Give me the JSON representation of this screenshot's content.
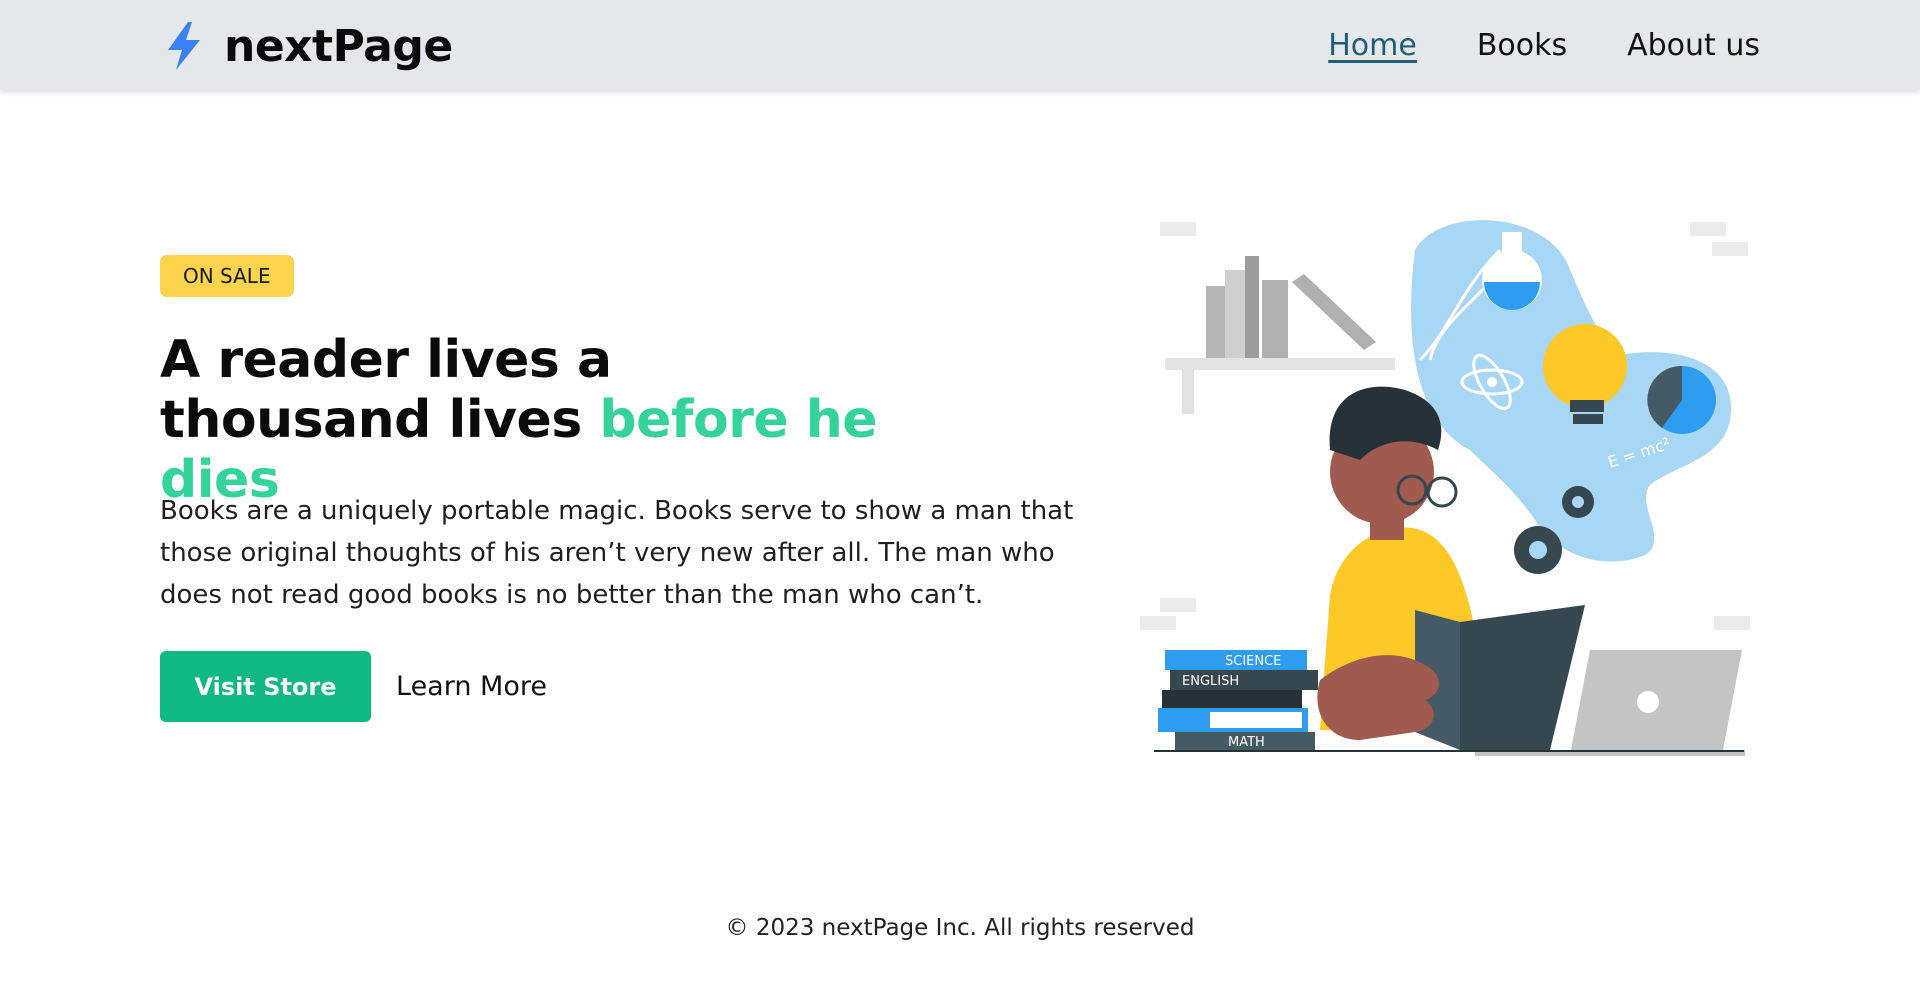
{
  "brand": {
    "name": "nextPage",
    "icon": "lightning-bolt-icon",
    "icon_color": "#3b82f6"
  },
  "nav": {
    "items": [
      {
        "label": "Home",
        "active": true
      },
      {
        "label": "Books",
        "active": false
      },
      {
        "label": "About us",
        "active": false
      }
    ]
  },
  "hero": {
    "badge": "ON SALE",
    "headline_line1": "A reader lives a",
    "headline_line2": "thousand lives ",
    "headline_accent": "before he dies",
    "paragraph": "Books are a uniquely portable magic. Books serve to show a man that those original thoughts of his aren’t very new after all. The man who does not read good books is no better than the man who can’t.",
    "primary_button": "Visit Store",
    "secondary_button": "Learn More"
  },
  "illustration": {
    "icon": "boy-reading-illustration",
    "book_labels": [
      "SCIENCE",
      "ENGLISH",
      "MATH"
    ],
    "formula": "E = mc²"
  },
  "footer": {
    "text": "© 2023 nextPage Inc. All rights reserved"
  },
  "colors": {
    "header_bg": "#e5e7eb",
    "accent_green": "#34d399",
    "button_green": "#10b981",
    "badge_yellow": "#fcd34d",
    "active_link": "#1f5f7a"
  }
}
